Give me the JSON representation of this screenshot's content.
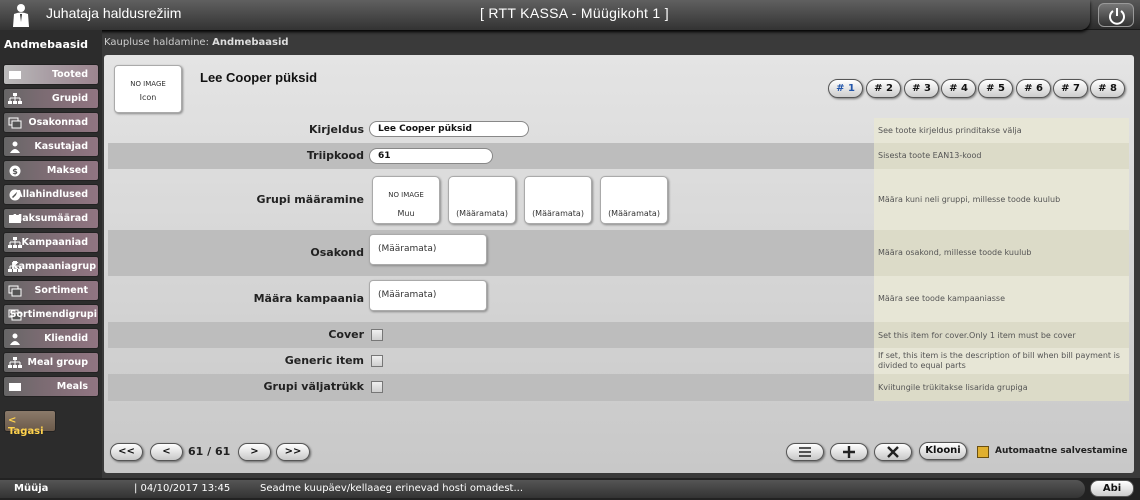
{
  "header": {
    "mode_title": "Juhataja haldusrežiim",
    "app_title": "[ RTT KASSA - Müügikoht 1 ]"
  },
  "sidebar": {
    "title": "Andmebaasid",
    "items": [
      {
        "label": "Tooted",
        "icon": "card-icon"
      },
      {
        "label": "Grupid",
        "icon": "hierarchy-icon"
      },
      {
        "label": "Osakonnad",
        "icon": "windows-icon"
      },
      {
        "label": "Kasutajad",
        "icon": "user-icon"
      },
      {
        "label": "Maksed",
        "icon": "coin-icon"
      },
      {
        "label": "Allahindlused",
        "icon": "discount-icon"
      },
      {
        "label": "Maksumäärad",
        "icon": "card-icon"
      },
      {
        "label": "Kampaaniad",
        "icon": "hierarchy-icon"
      },
      {
        "label": "Kampaaniagrup",
        "icon": "hierarchy-icon"
      },
      {
        "label": "Sortiment",
        "icon": "windows-icon"
      },
      {
        "label": "Sortimendigrupi",
        "icon": "windows-icon"
      },
      {
        "label": "Kliendid",
        "icon": "user-icon"
      },
      {
        "label": "Meal group",
        "icon": "hierarchy-icon"
      },
      {
        "label": "Meals",
        "icon": "card-icon"
      }
    ],
    "back_label": "< Tagasi"
  },
  "breadcrumb": {
    "prefix": "Kaupluse haldamine:",
    "current": "Andmebaasid"
  },
  "product": {
    "image_placeholder": "NO IMAGE",
    "image_caption": "Icon",
    "title": "Lee Cooper püksid",
    "tabs": [
      "# 1",
      "# 2",
      "# 3",
      "# 4",
      "# 5",
      "# 6",
      "# 7",
      "# 8"
    ]
  },
  "form": {
    "kirjeldus": {
      "label": "Kirjeldus",
      "value": "Lee Cooper püksid",
      "desc": "See toote kirjeldus prinditakse välja"
    },
    "triipkood": {
      "label": "Triipkood",
      "value": "61",
      "desc": "Sisesta toote EAN13-kood"
    },
    "grupp": {
      "label": "Grupi määramine",
      "boxes": [
        {
          "top": "NO IMAGE",
          "bottom": "Muu"
        },
        {
          "top": "",
          "bottom": "(Määramata)"
        },
        {
          "top": "",
          "bottom": "(Määramata)"
        },
        {
          "top": "",
          "bottom": "(Määramata)"
        }
      ],
      "desc": "Määra kuni neli gruppi, millesse toode kuulub"
    },
    "osakond": {
      "label": "Osakond",
      "value": "(Määramata)",
      "desc": "Määra osakond, millesse toode kuulub"
    },
    "kampaania": {
      "label": "Määra kampaania",
      "value": "(Määramata)",
      "desc": "Määra see toode kampaaniasse"
    },
    "cover": {
      "label": "Cover",
      "desc": "Set this item for cover.Only 1 item must be cover"
    },
    "generic": {
      "label": "Generic item",
      "desc": "If set, this item is the description of bill when bill payment is divided to equal parts"
    },
    "valjatrukk": {
      "label": "Grupi väljatrükk",
      "desc": "Kviitungile trükitakse lisarida grupiga"
    }
  },
  "footer": {
    "first": "<<",
    "prev": "<",
    "pager": "61 / 61",
    "next": ">",
    "last": ">>",
    "clone": "Klooni",
    "autosave": "Automaatne salvestamine"
  },
  "status": {
    "role": "Müüja",
    "datetime": "| 04/10/2017 13:45",
    "message": "Seadme kuupäev/kellaaeg erinevad hosti omadest...",
    "help": "Abi"
  }
}
